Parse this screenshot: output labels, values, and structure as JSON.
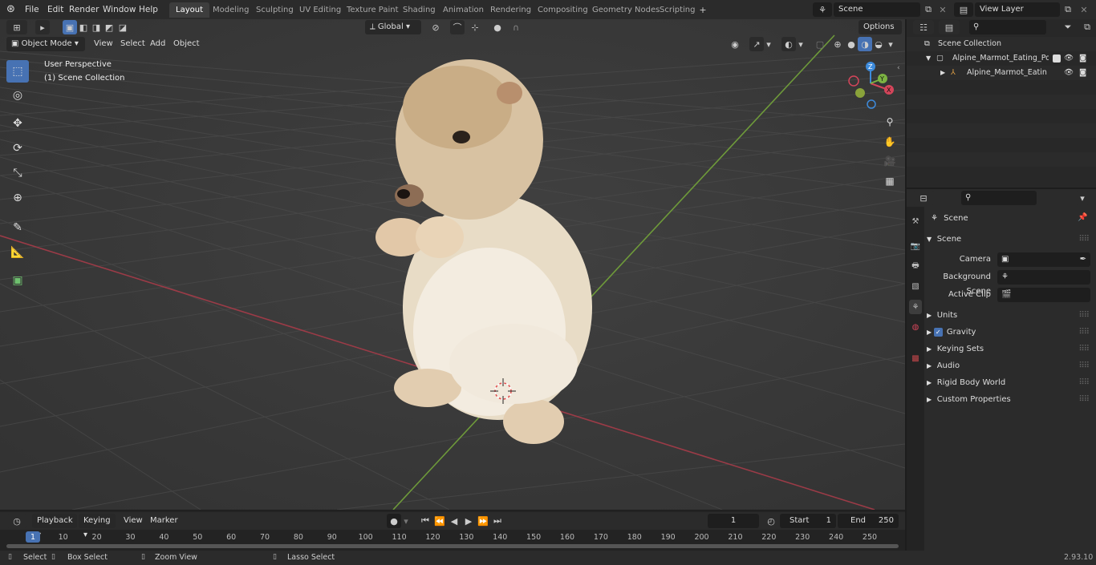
{
  "menu": {
    "file": "File",
    "edit": "Edit",
    "render": "Render",
    "window": "Window",
    "help": "Help"
  },
  "workspaces": [
    "Layout",
    "Modeling",
    "Sculpting",
    "UV Editing",
    "Texture Paint",
    "Shading",
    "Animation",
    "Rendering",
    "Compositing",
    "Geometry Nodes",
    "Scripting"
  ],
  "scene_field": "Scene",
  "view_layer_field": "View Layer",
  "viewport": {
    "mode": "Object Mode",
    "menus": [
      "View",
      "Select",
      "Add",
      "Object"
    ],
    "transform_orientation": "Global",
    "options": "Options",
    "overlay_title": "User Perspective",
    "overlay_subtitle": "(1) Scene Collection",
    "gizmo": {
      "z": "Z",
      "y": "Y",
      "x": "X"
    }
  },
  "timeline": {
    "menus": [
      "Playback",
      "Keying",
      "View",
      "Marker"
    ],
    "current_frame": "1",
    "start_label": "Start",
    "start_value": "1",
    "end_label": "End",
    "end_value": "250",
    "ticks": [
      "1",
      "10",
      "20",
      "30",
      "40",
      "50",
      "60",
      "70",
      "80",
      "90",
      "100",
      "110",
      "120",
      "130",
      "140",
      "150",
      "160",
      "170",
      "180",
      "190",
      "200",
      "210",
      "220",
      "230",
      "240",
      "250"
    ]
  },
  "statusbar": {
    "select": "Select",
    "box_select": "Box Select",
    "zoom_view": "Zoom View",
    "lasso_select": "Lasso Select",
    "version": "2.93.10"
  },
  "outliner": {
    "root": "Scene Collection",
    "item1": "Alpine_Marmot_Eating_Pose_",
    "item2": "Alpine_Marmot_Eating_P"
  },
  "properties": {
    "context": "Scene",
    "panel_scene": "Scene",
    "camera_label": "Camera",
    "background_scene_label": "Background Scene",
    "active_clip_label": "Active Clip",
    "panels": [
      "Units",
      "Gravity",
      "Keying Sets",
      "Audio",
      "Rigid Body World",
      "Custom Properties"
    ]
  },
  "colors": {
    "accent": "#4772b3",
    "x_axis": "#d4455a",
    "y_axis": "#7cb342",
    "z_axis": "#3d8bdc"
  }
}
